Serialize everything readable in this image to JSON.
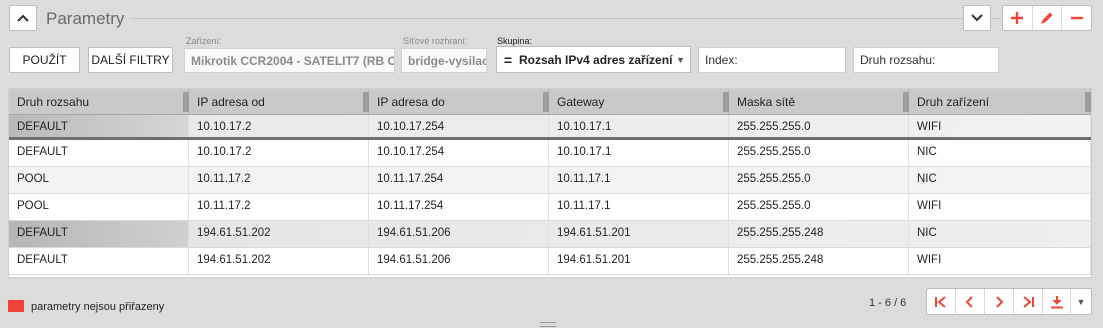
{
  "panel": {
    "title": "Parametry"
  },
  "toolbar": {
    "apply_label": "POUŽÍT",
    "filters_label": "DALŠÍ FILTRY",
    "device_label": "Zařízení:",
    "device_value": "Mikrotik CCR2004 - SATELIT7 (RB C",
    "iface_label": "Síťové rozhraní:",
    "iface_value": "bridge-vysilac",
    "group_label": "Skupina:",
    "group_value": "Rozsah IPv4 adres zařízení",
    "index_placeholder": "Index:",
    "range_type_placeholder": "Druh rozsahu:"
  },
  "table": {
    "columns": [
      "Druh rozsahu",
      "IP adresa od",
      "IP adresa do",
      "Gateway",
      "Maska sítě",
      "Druh zařízení"
    ],
    "rows": [
      [
        "DEFAULT",
        "10.10.17.2",
        "10.10.17.254",
        "10.10.17.1",
        "255.255.255.0",
        "WIFI"
      ],
      [
        "DEFAULT",
        "10.10.17.2",
        "10.10.17.254",
        "10.10.17.1",
        "255.255.255.0",
        "NIC"
      ],
      [
        "POOL",
        "10.11.17.2",
        "10.11.17.254",
        "10.11.17.1",
        "255.255.255.0",
        "NIC"
      ],
      [
        "POOL",
        "10.11.17.2",
        "10.11.17.254",
        "10.11.17.1",
        "255.255.255.0",
        "WIFI"
      ],
      [
        "DEFAULT",
        "194.61.51.202",
        "194.61.51.206",
        "194.61.51.201",
        "255.255.255.248",
        "NIC"
      ],
      [
        "DEFAULT",
        "194.61.51.202",
        "194.61.51.206",
        "194.61.51.201",
        "255.255.255.248",
        "WIFI"
      ]
    ]
  },
  "footer": {
    "legend_text": "parametry nejsou přiřazeny",
    "page_info": "1 - 6 / 6"
  },
  "colors": {
    "accent": "#f04438",
    "legend": "#f04438"
  },
  "icons": [
    "chevron-up-icon",
    "chevron-down-icon",
    "plus-icon",
    "pencil-icon",
    "minus-icon",
    "first-page-icon",
    "prev-page-icon",
    "next-page-icon",
    "last-page-icon",
    "download-icon"
  ]
}
